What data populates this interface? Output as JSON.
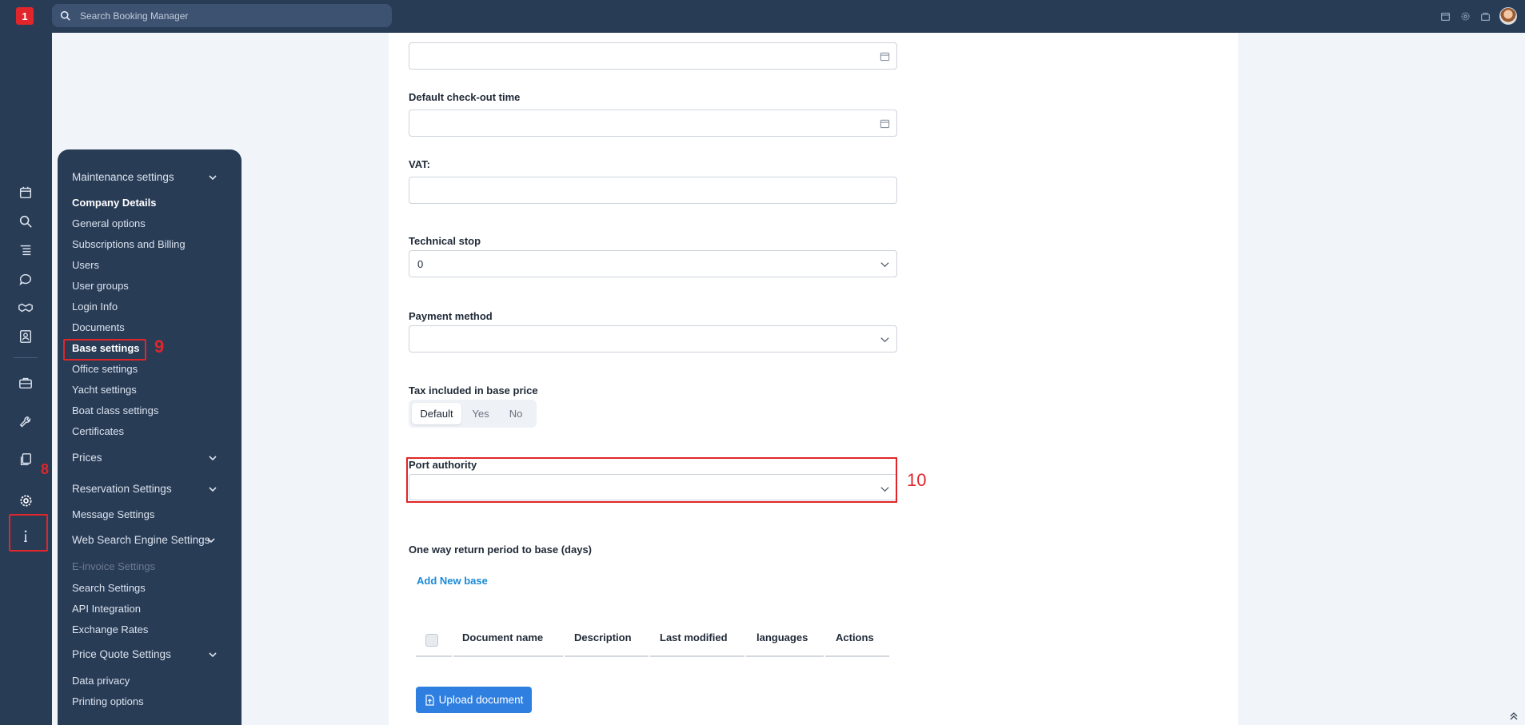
{
  "app": {
    "search_placeholder": "Search Booking Manager",
    "logo_text": "1"
  },
  "top_icons": [
    "calendar-icon",
    "gear-icon",
    "bag-icon",
    "user-avatar"
  ],
  "rail_icons": [
    "calendar-icon",
    "search-icon",
    "list-icon",
    "chat-icon",
    "handshake-icon",
    "contacts-icon",
    "briefcase-icon",
    "wrench-icon",
    "documents-icon",
    "gear-icon",
    "info-icon"
  ],
  "annotations": {
    "rail_settings": "8",
    "base_settings": "9",
    "port_authority": "10"
  },
  "menu": {
    "maintenance": "Maintenance settings",
    "company_details": "Company Details",
    "general_options": "General options",
    "subscriptions": "Subscriptions and Billing",
    "users": "Users",
    "user_groups": "User groups",
    "login_info": "Login Info",
    "documents": "Documents",
    "base_settings": "Base settings",
    "office_settings": "Office settings",
    "yacht_settings": "Yacht settings",
    "boat_class": "Boat class settings",
    "certificates": "Certificates",
    "prices": "Prices",
    "reservation": "Reservation Settings",
    "message": "Message Settings",
    "web_search": "Web Search Engine Settings",
    "einvoice": "E-invoice Settings",
    "search_settings": "Search Settings",
    "api": "API Integration",
    "exchange": "Exchange Rates",
    "price_quote": "Price Quote Settings",
    "data_privacy": "Data privacy",
    "printing": "Printing options"
  },
  "form": {
    "checkin_value": "",
    "checkout_label": "Default check-out time",
    "checkout_value": "",
    "vat_label": "VAT:",
    "vat_value": "",
    "technical_stop_label": "Technical stop",
    "technical_stop_value": "0",
    "payment_label": "Payment method",
    "payment_value": "",
    "tax_label": "Tax included in base price",
    "tax_options": [
      "Default",
      "Yes",
      "No"
    ],
    "tax_selected": "Default",
    "port_label": "Port authority",
    "port_value": "",
    "oneway_label": "One way return period to base (days)",
    "add_base": "Add New base"
  },
  "table": {
    "columns": [
      "Document name",
      "Description",
      "Last modified",
      "languages",
      "Actions"
    ]
  },
  "upload_label": "Upload document",
  "colors": {
    "nav": "#293c56",
    "accent_red": "#e0262a",
    "link_blue": "#1a8ad8",
    "button_blue": "#2f7fe0"
  }
}
